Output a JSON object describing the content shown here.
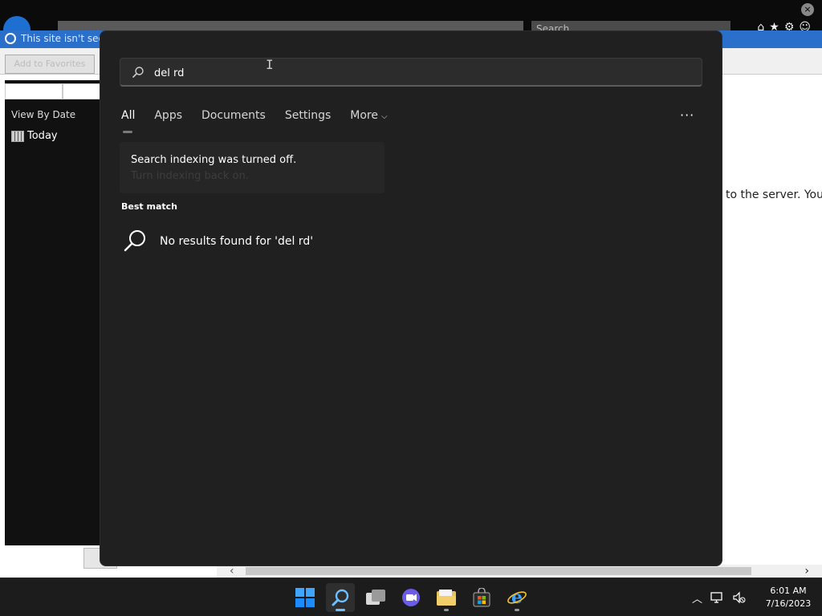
{
  "background_browser": {
    "cert_warning": "This site isn't secure",
    "search_placeholder": "Search...",
    "add_to_favorites": "Add to Favorites",
    "sidebar_header": "View By Date",
    "sidebar_item": "Today",
    "content_fragment": "to the server. You"
  },
  "search": {
    "query": "del rd",
    "tabs": [
      "All",
      "Apps",
      "Documents",
      "Settings",
      "More"
    ],
    "active_tab": "All",
    "overflow_label": "···",
    "indexing_notice": {
      "title": "Search indexing was turned off.",
      "link": "Turn indexing back on."
    },
    "best_match_label": "Best match",
    "no_results_text": "No results found for 'del rd'"
  },
  "taskbar": {
    "apps": [
      "start",
      "search",
      "task-view",
      "chat",
      "file-explorer",
      "microsoft-store",
      "internet-explorer"
    ],
    "active_app": "search",
    "clock": {
      "time": "6:01 AM",
      "date": "7/16/2023"
    }
  },
  "colors": {
    "accent": "#0078d4",
    "panel_bg": "#202020",
    "taskbar_bg": "#1c1c1c"
  }
}
